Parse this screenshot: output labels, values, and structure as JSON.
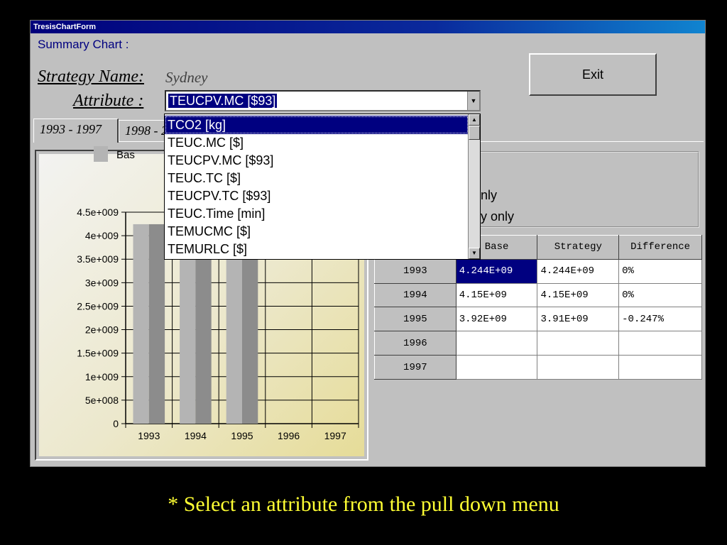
{
  "window": {
    "title": "TresisChartForm"
  },
  "form": {
    "summary_label": "Summary Chart :",
    "strategy_label": "Strategy Name:",
    "strategy_value": "Sydney",
    "attribute_label": "Attribute :",
    "attribute_value": "TEUCPV.MC [$93]",
    "exit_label": "Exit"
  },
  "tabs": [
    {
      "label": "1993 - 1997"
    },
    {
      "label": "1998 - 2"
    }
  ],
  "dropdown": {
    "items": [
      {
        "label": "TCO2 [kg]"
      },
      {
        "label": "TEUC.MC [$]"
      },
      {
        "label": "TEUCPV.MC [$93]"
      },
      {
        "label": "TEUC.TC [$]"
      },
      {
        "label": "TEUCPV.TC [$93]"
      },
      {
        "label": "TEUC.Time [min]"
      },
      {
        "label": "TEMUCMC [$]"
      },
      {
        "label": "TEMURLC [$]"
      }
    ],
    "selected_index": 0
  },
  "legend": {
    "base_label": "Bas"
  },
  "options": {
    "radio_base_only": "nly",
    "radio_strategy_only": "y only"
  },
  "table": {
    "headers": [
      "",
      "Base",
      "Strategy",
      "Difference"
    ],
    "rows": [
      {
        "year": "1993",
        "base": "4.244E+09",
        "strategy": "4.244E+09",
        "difference": "0%"
      },
      {
        "year": "1994",
        "base": "4.15E+09",
        "strategy": "4.15E+09",
        "difference": "0%"
      },
      {
        "year": "1995",
        "base": "3.92E+09",
        "strategy": "3.91E+09",
        "difference": "-0.247%"
      },
      {
        "year": "1996",
        "base": "",
        "strategy": "",
        "difference": ""
      },
      {
        "year": "1997",
        "base": "",
        "strategy": "",
        "difference": ""
      }
    ]
  },
  "chart_data": {
    "type": "bar",
    "categories": [
      "1993",
      "1994",
      "1995",
      "1996",
      "1997"
    ],
    "series": [
      {
        "name": "Bas",
        "values": [
          4244000000.0,
          4150000000.0,
          3920000000.0,
          null,
          null
        ],
        "color": "#b4b4b4"
      },
      {
        "values": [
          4244000000.0,
          4150000000.0,
          3910000000.0,
          null,
          null
        ],
        "color": "#8c8c8c"
      }
    ],
    "ytick_labels": [
      "0",
      "5e+008",
      "1e+009",
      "1.5e+009",
      "2e+009",
      "2.5e+009",
      "3e+009",
      "3.5e+009",
      "4e+009",
      "4.5e+009"
    ],
    "ylim": [
      0,
      4500000000.0
    ],
    "grid": true
  },
  "caption": "* Select an attribute from the pull down menu"
}
